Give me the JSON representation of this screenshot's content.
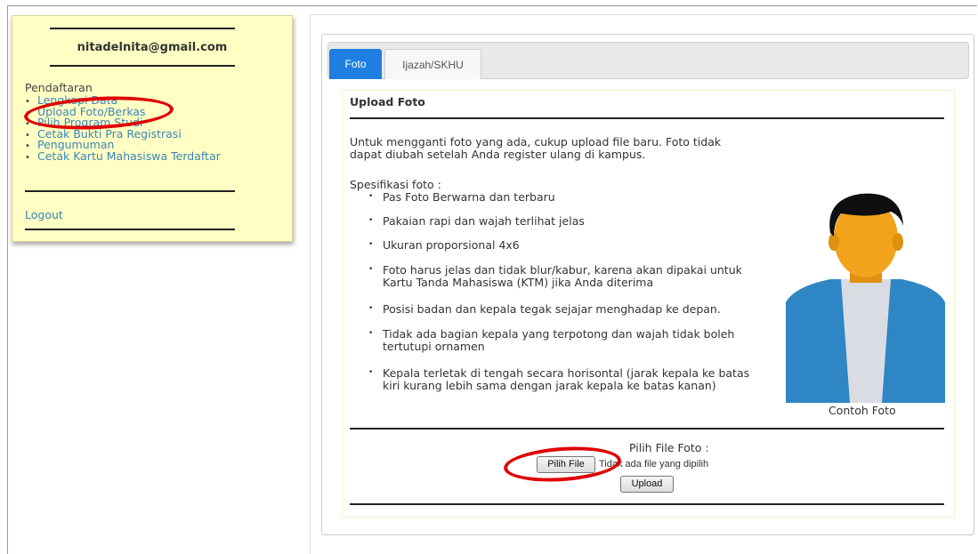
{
  "sidebar": {
    "email": "nitadelnita@gmail.com",
    "section": "Pendaftaran",
    "items": [
      {
        "label": "Lengkapi Data"
      },
      {
        "label": "Upload Foto/Berkas"
      },
      {
        "label": "Pilih Program Studi"
      },
      {
        "label": "Cetak Bukti Pra Registrasi"
      },
      {
        "label": "Pengumuman"
      },
      {
        "label": "Cetak Kartu Mahasiswa Terdaftar"
      }
    ],
    "logout": "Logout"
  },
  "tabs": [
    {
      "label": "Foto"
    },
    {
      "label": "Ijazah/SKHU"
    }
  ],
  "upload": {
    "heading": "Upload Foto",
    "intro_line1": "Untuk mengganti foto yang ada, cukup upload file baru. Foto tidak",
    "intro_line2": "dapat diubah setelah Anda register ulang di kampus.",
    "spec_title": "Spesifikasi foto :",
    "specs": [
      "Pas Foto Berwarna dan terbaru",
      "Pakaian rapi dan wajah terlihat jelas",
      "Ukuran proporsional 4x6",
      "Foto harus jelas dan tidak blur/kabur, karena akan dipakai untuk",
      "Kartu Tanda Mahasiswa (KTM) jika Anda diterima",
      "Posisi badan dan kepala tegak sejajar menghadap ke depan.",
      "Tidak ada bagian kepala yang terpotong dan wajah tidak boleh",
      "tertutupi ornamen",
      "Kepala terletak di tengah secara horisontal (jarak kepala ke batas",
      "kiri kurang lebih sama dengan jarak kepala ke batas kanan)"
    ],
    "photo_caption": "Contoh Foto",
    "file_label": "Pilih File Foto :",
    "choose_button": "Pilih File",
    "no_file_text": "Tidak ada file yang dipilih",
    "upload_button": "Upload"
  },
  "colors": {
    "sidebar_bg": "#ffffc4",
    "link": "#3a86b8",
    "active_tab": "#1f7fe0",
    "highlight_ring": "#e00000"
  }
}
